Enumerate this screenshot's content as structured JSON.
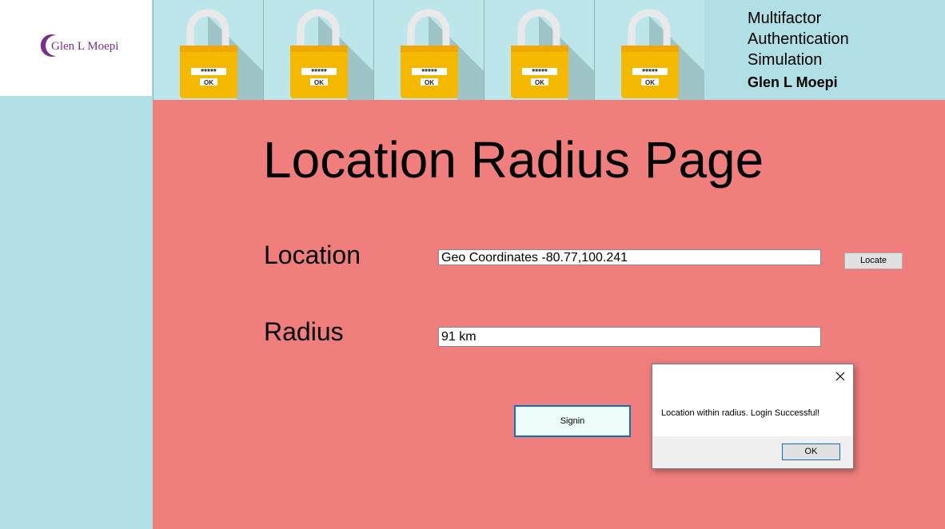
{
  "logo": {
    "text": "Glen L Moepi",
    "accent": "#7a2e8f"
  },
  "lock_tiles": [
    {
      "password": "*****",
      "button": "OK"
    },
    {
      "password": "*****",
      "button": "OK"
    },
    {
      "password": "*****",
      "button": "OK"
    },
    {
      "password": "*****",
      "button": "OK"
    },
    {
      "password": "*****",
      "button": "OK"
    }
  ],
  "header": {
    "title_lines": [
      "Multifactor",
      "Authentication",
      "Simulation"
    ],
    "author": "Glen L Moepi"
  },
  "page": {
    "title": "Location Radius Page",
    "location_label": "Location",
    "location_value": "Geo Coordinates -80.77,100.241",
    "locate_button": "Locate",
    "radius_label": "Radius",
    "radius_value": "91 km",
    "signin_button": "Signin"
  },
  "dialog": {
    "message": "Location within radius. Login Successful!",
    "ok_button": "OK",
    "close_icon": "close-icon"
  },
  "colors": {
    "background": "#b0dfe5",
    "content": "#ef7e7d",
    "lock_body": "#f5b800",
    "focus_border": "#0a6fc7"
  }
}
